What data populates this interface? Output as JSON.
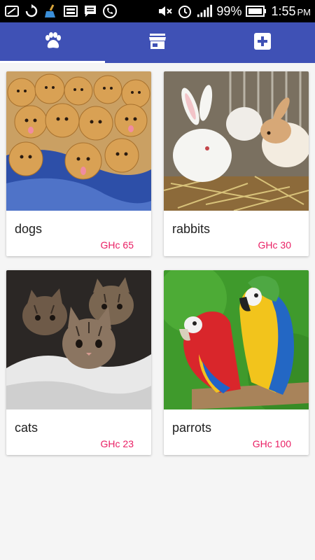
{
  "status_bar": {
    "battery": "99%",
    "time": "1:55",
    "ampm": "PM",
    "icons": [
      "chrome-icon",
      "sync-icon",
      "broom-icon",
      "screen-icon",
      "message-icon",
      "whatsapp-icon",
      "mute-icon",
      "alarm-icon",
      "signal-icon",
      "battery-icon"
    ]
  },
  "tabs": [
    {
      "icon": "paw-icon",
      "active": true
    },
    {
      "icon": "store-icon",
      "active": false
    },
    {
      "icon": "add-box-icon",
      "active": false
    }
  ],
  "pets": [
    {
      "name": "dogs",
      "price": "GHc 65",
      "photo": "puppies-photo"
    },
    {
      "name": "rabbits",
      "price": "GHc 30",
      "photo": "rabbits-photo"
    },
    {
      "name": "cats",
      "price": "GHc 23",
      "photo": "kittens-photo"
    },
    {
      "name": "parrots",
      "price": "GHc 100",
      "photo": "parrots-photo"
    }
  ],
  "colors": {
    "primary": "#3f51b5",
    "accent_price": "#e91e63",
    "background": "#f5f5f5"
  }
}
